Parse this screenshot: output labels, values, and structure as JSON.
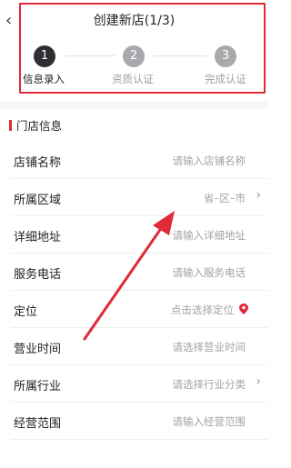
{
  "header": {
    "title": "创建新店(1/3)",
    "back_icon": "chevron-left-icon",
    "steps": [
      {
        "number": "1",
        "label": "信息录入",
        "state": "active"
      },
      {
        "number": "2",
        "label": "资质认证",
        "state": "inactive"
      },
      {
        "number": "3",
        "label": "完成认证",
        "state": "inactive"
      }
    ]
  },
  "section": {
    "title": "门店信息"
  },
  "form": {
    "rows": [
      {
        "label": "店铺名称",
        "value": "请输入店铺名称"
      },
      {
        "label": "所属区域",
        "value": "省–区–市"
      },
      {
        "label": "详细地址",
        "value": "请输入详细地址"
      },
      {
        "label": "服务电话",
        "value": "请输入服务电话"
      },
      {
        "label": "定位",
        "value": "点击选择定位"
      },
      {
        "label": "营业时间",
        "value": "请选择营业时间"
      },
      {
        "label": "所属行业",
        "value": "请选择行业分类"
      },
      {
        "label": "经营范围",
        "value": "请输入经营范围"
      }
    ]
  },
  "colors": {
    "accent_red": "#e02a3a",
    "step_active": "#2d2e33",
    "step_inactive": "#a9a9ad",
    "placeholder": "#a3a3a6"
  }
}
